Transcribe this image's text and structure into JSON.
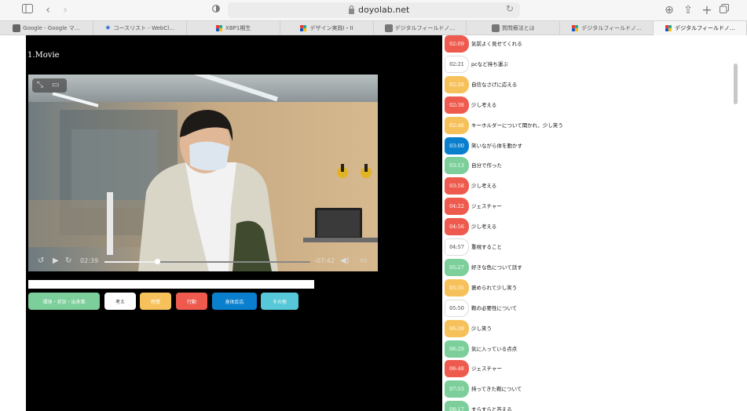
{
  "browser": {
    "url": "doyolab.net",
    "tabs": [
      {
        "label": "Google - Google マ…",
        "favicon": "google-icon"
      },
      {
        "label": "コースリスト - WebCl…",
        "favicon": "star-icon"
      },
      {
        "label": "XBP1期生",
        "favicon": "doyolab-logo-icon"
      },
      {
        "label": "デザイン実践I・II",
        "favicon": "doyolab-logo-icon"
      },
      {
        "label": "デジタルフィールドノ…",
        "favicon": "m-icon"
      },
      {
        "label": "質問療法とは",
        "favicon": "m-icon"
      },
      {
        "label": "デジタルフィールドノ…",
        "favicon": "doyolab-logo-icon"
      },
      {
        "label": "デジタルフィールドノ…",
        "favicon": "doyolab-logo-icon"
      }
    ]
  },
  "main": {
    "movie_title": "1.Movie",
    "video": {
      "elapsed": "02:39",
      "remaining": "-07:42",
      "played_fraction": 0.255
    },
    "categories": [
      {
        "label": "環境・状況・出来事",
        "color": "#7ccf9a"
      },
      {
        "label": "考え",
        "color": "#ffffff"
      },
      {
        "label": "感情",
        "color": "#f6c15a"
      },
      {
        "label": "行動",
        "color": "#ee5b4e"
      },
      {
        "label": "身体反応",
        "color": "#0a7fce"
      },
      {
        "label": "その他",
        "color": "#56c8d8"
      }
    ]
  },
  "timeline": [
    {
      "time": "02:09",
      "text": "気前よく見せてくれる",
      "color": "#ee5b4e"
    },
    {
      "time": "02:21",
      "text": "pcなど持ち運ぶ",
      "color": "#ffffff"
    },
    {
      "time": "02:26",
      "text": "自信なさげに応える",
      "color": "#f6c15a"
    },
    {
      "time": "02:38",
      "text": "少し考える",
      "color": "#ee5b4e"
    },
    {
      "time": "02:46",
      "text": "キーホルダーについて聞かれ、少し笑う",
      "color": "#f6c15a"
    },
    {
      "time": "03:00",
      "text": "笑いながら体を動かす",
      "color": "#0a7fce"
    },
    {
      "time": "03:13",
      "text": "自分で作った",
      "color": "#7ccf9a"
    },
    {
      "time": "03:58",
      "text": "少し考える",
      "color": "#ee5b4e"
    },
    {
      "time": "04:22",
      "text": "ジェスチャー",
      "color": "#ee5b4e"
    },
    {
      "time": "04:56",
      "text": "少し考える",
      "color": "#ee5b4e"
    },
    {
      "time": "04:57",
      "text": "重視すること",
      "color": "#ffffff"
    },
    {
      "time": "05:27",
      "text": "好きな色について話す",
      "color": "#7ccf9a"
    },
    {
      "time": "05:35",
      "text": "褒められて少し笑う",
      "color": "#f6c15a"
    },
    {
      "time": "05:50",
      "text": "鞄の必要性について",
      "color": "#ffffff"
    },
    {
      "time": "06:28",
      "text": "少し笑う",
      "color": "#f6c15a"
    },
    {
      "time": "06:29",
      "text": "気に入っている点点",
      "color": "#7ccf9a"
    },
    {
      "time": "06:48",
      "text": "ジェスチャー",
      "color": "#ee5b4e"
    },
    {
      "time": "07:53",
      "text": "持ってきた鞄について",
      "color": "#7ccf9a"
    },
    {
      "time": "08:17",
      "text": "すらすらと答える",
      "color": "#7ccf9a"
    }
  ]
}
